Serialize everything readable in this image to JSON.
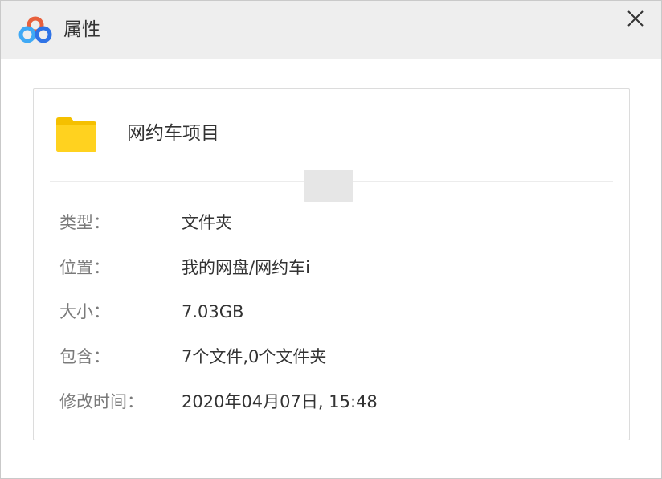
{
  "window": {
    "title": "属性",
    "close_symbol": "✕",
    "logo_icon": "app-logo-icon"
  },
  "item": {
    "icon": "folder-icon",
    "icon_color": "#FFCC00",
    "name": "网约车项目"
  },
  "properties": [
    {
      "label": "类型：",
      "value": "文件夹"
    },
    {
      "label": "位置：",
      "value": "我的网盘/网约车i"
    },
    {
      "label": "大小：",
      "value": "7.03GB"
    },
    {
      "label": "包含：",
      "value": "7个文件,0个文件夹"
    },
    {
      "label": "修改时间：",
      "value": "2020年04月07日, 15:48"
    }
  ]
}
